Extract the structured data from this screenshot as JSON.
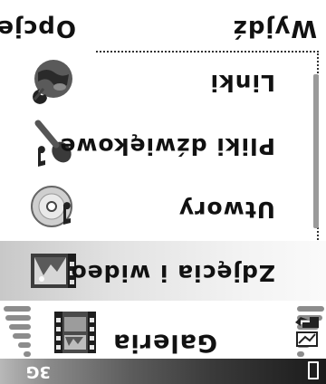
{
  "status_bar": {
    "network_label": "3G",
    "app_title": "Galeria",
    "app_icon": "film-strip-icon",
    "mode_icon": "phone-mode-icon",
    "battery_icon": "battery-icon"
  },
  "list": {
    "items": [
      {
        "label": "Zdjęcia i wideo",
        "icon": "photo-video-icon",
        "selected": true
      },
      {
        "label": "Utwory",
        "icon": "music-cd-icon",
        "selected": false
      },
      {
        "label": "Pliki dźwiękowe",
        "icon": "microphone-icon",
        "selected": false
      },
      {
        "label": "Linki",
        "icon": "globe-link-icon",
        "selected": false
      }
    ]
  },
  "softkeys": {
    "left": "Opcje",
    "right": "Wyjdź"
  },
  "colors": {
    "selection_highlight": "#d8d8d8",
    "status_strip": "#3a3a3a",
    "text": "#111111"
  }
}
